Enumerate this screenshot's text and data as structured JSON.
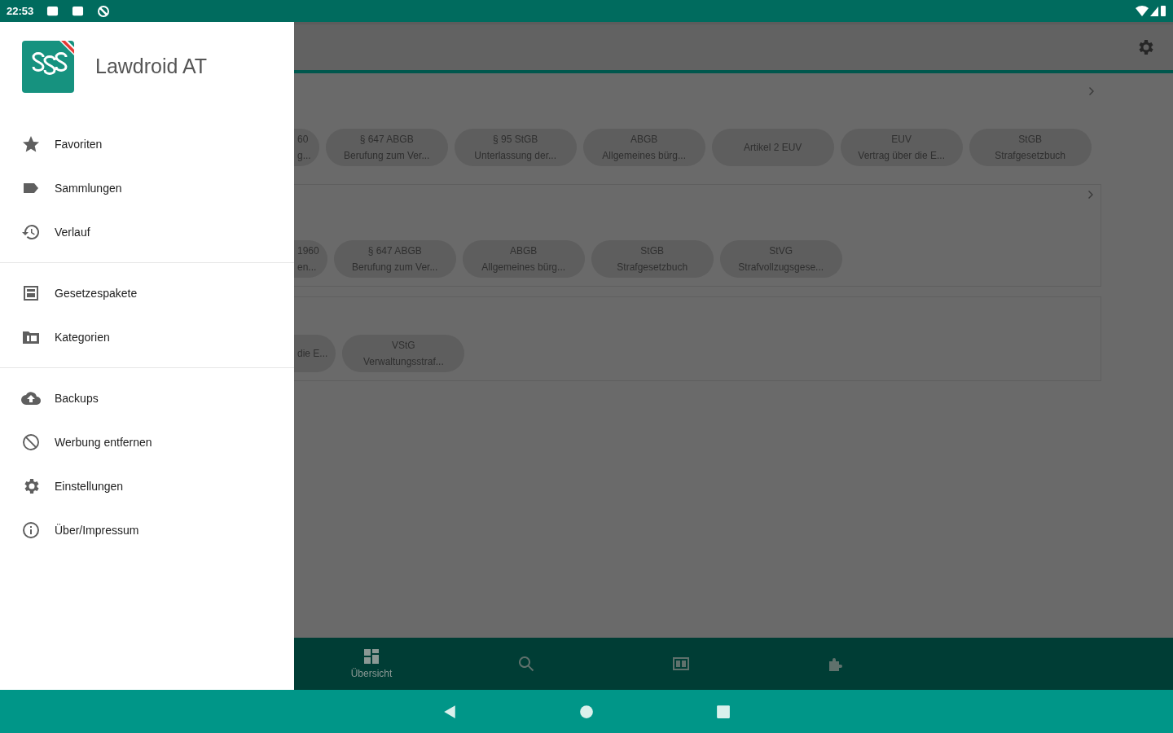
{
  "status_bar": {
    "time": "22:53"
  },
  "drawer": {
    "app_name": "Lawdroid AT",
    "groups": [
      [
        {
          "kind": "star",
          "label": "Favoriten"
        },
        {
          "kind": "tag",
          "label": "Sammlungen"
        },
        {
          "kind": "history",
          "label": "Verlauf"
        }
      ],
      [
        {
          "kind": "package",
          "label": "Gesetzespakete"
        },
        {
          "kind": "folder",
          "label": "Kategorien"
        }
      ],
      [
        {
          "kind": "cloud",
          "label": "Backups"
        },
        {
          "kind": "block",
          "label": "Werbung entfernen"
        },
        {
          "kind": "gear",
          "label": "Einstellungen"
        },
        {
          "kind": "info",
          "label": "Über/Impressum"
        }
      ]
    ]
  },
  "sections": [
    {
      "chevron": true,
      "carded": false,
      "chips": [
        {
          "title": "60",
          "subtitle": "g...",
          "partial": true
        },
        {
          "title": "§ 647 ABGB",
          "subtitle": "Berufung zum Ver...",
          "partial": false
        },
        {
          "title": "§ 95 StGB",
          "subtitle": "Unterlassung der...",
          "partial": false
        },
        {
          "title": "ABGB",
          "subtitle": "Allgemeines bürg...",
          "partial": false
        },
        {
          "title": "Artikel 2 EUV",
          "partial": false
        },
        {
          "title": "EUV",
          "subtitle": "Vertrag über die E...",
          "partial": false
        },
        {
          "title": "StGB",
          "subtitle": "Strafgesetzbuch",
          "partial": false
        }
      ]
    },
    {
      "chevron": true,
      "carded": true,
      "chips": [
        {
          "title": "1960",
          "subtitle": "en...",
          "partial": true
        },
        {
          "title": "§ 647 ABGB",
          "subtitle": "Berufung zum Ver...",
          "partial": false
        },
        {
          "title": "ABGB",
          "subtitle": "Allgemeines bürg...",
          "partial": false
        },
        {
          "title": "StGB",
          "subtitle": "Strafgesetzbuch",
          "partial": false
        },
        {
          "title": "StVG",
          "subtitle": "Strafvollzugsgese...",
          "partial": false
        }
      ]
    },
    {
      "chevron": false,
      "carded": true,
      "chips": [
        {
          "subtitle": "die E...",
          "partial": true
        },
        {
          "title": "VStG",
          "subtitle": "Verwaltungsstraf...",
          "partial": false
        }
      ]
    }
  ],
  "bottom_nav": [
    {
      "kind": "overview",
      "label": "Übersicht",
      "selected": true
    },
    {
      "kind": "search",
      "selected": false
    },
    {
      "kind": "book",
      "selected": false
    },
    {
      "kind": "puzzle",
      "selected": false
    }
  ]
}
